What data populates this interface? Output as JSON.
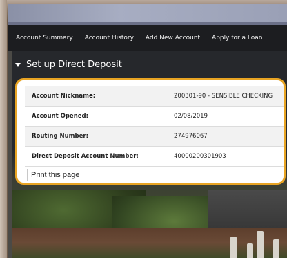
{
  "nav": {
    "items": [
      {
        "label": "Account Summary"
      },
      {
        "label": "Account History"
      },
      {
        "label": "Add New Account"
      },
      {
        "label": "Apply for a Loan"
      }
    ]
  },
  "section": {
    "title": "Set up Direct Deposit"
  },
  "details": {
    "rows": [
      {
        "label": "Account Nickname:",
        "value": "200301-90 - SENSIBLE CHECKING"
      },
      {
        "label": "Account Opened:",
        "value": "02/08/2019"
      },
      {
        "label": "Routing Number:",
        "value": "274976067"
      },
      {
        "label": "Direct Deposit Account Number:",
        "value": "40000200301903"
      }
    ]
  },
  "actions": {
    "print_label": "Print this page"
  },
  "colors": {
    "highlight_border": "#e8a423",
    "nav_background": "#1c1d20"
  }
}
